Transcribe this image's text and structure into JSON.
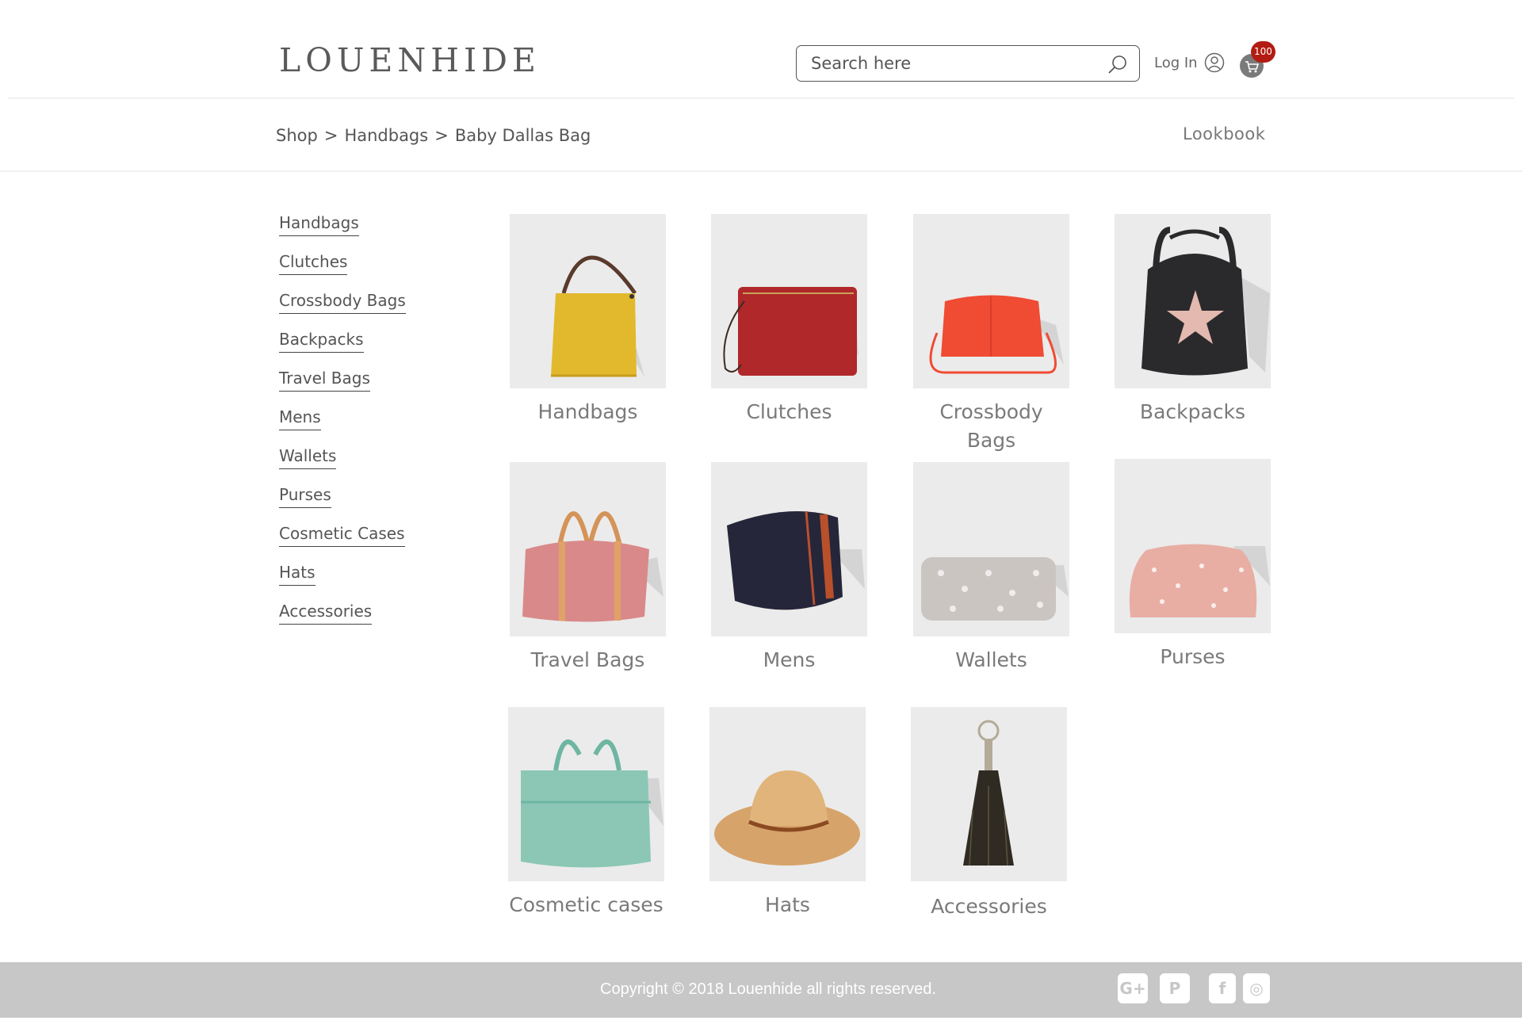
{
  "header": {
    "logo": "LOUENHIDE",
    "search_placeholder": "Search here",
    "login_label": "Log In",
    "cart_count": "100"
  },
  "breadcrumb": {
    "items": [
      "Shop",
      ">",
      "Handbags",
      ">",
      "Baby Dallas Bag"
    ]
  },
  "lookbook_label": "Lookbook",
  "sidebar": {
    "items": [
      {
        "label": "Handbags"
      },
      {
        "label": "Clutches"
      },
      {
        "label": "Crossbody Bags"
      },
      {
        "label": "Backpacks"
      },
      {
        "label": "Travel Bags"
      },
      {
        "label": "Mens"
      },
      {
        "label": "Wallets"
      },
      {
        "label": "Purses"
      },
      {
        "label": "Cosmetic Cases"
      },
      {
        "label": "Hats"
      },
      {
        "label": "Accessories"
      }
    ]
  },
  "categories": [
    {
      "label": "Handbags",
      "icon": "yellow-handbag-image",
      "color": "#e2b92d"
    },
    {
      "label": "Clutches",
      "icon": "red-clutch-image",
      "color": "#b0282a"
    },
    {
      "label": "Crossbody Bags",
      "icon": "orange-crossbody-image",
      "color": "#f04b33"
    },
    {
      "label": "Backpacks",
      "icon": "black-star-backpack-image",
      "color": "#2a2a2c"
    },
    {
      "label": "Travel Bags",
      "icon": "pink-travel-bag-image",
      "color": "#d9898a"
    },
    {
      "label": "Mens",
      "icon": "navy-toiletry-bag-image",
      "color": "#26263a"
    },
    {
      "label": "Wallets",
      "icon": "grey-pattern-pouch-image",
      "color": "#cbc5c1"
    },
    {
      "label": "Purses",
      "icon": "pink-spotted-purse-image",
      "color": "#e8aea4"
    },
    {
      "label": "Cosmetic cases",
      "icon": "mint-cosmetic-case-image",
      "color": "#8cc7b6"
    },
    {
      "label": "Hats",
      "icon": "straw-hat-image",
      "color": "#d6a36b"
    },
    {
      "label": "Accessories",
      "icon": "tassel-keyring-image",
      "color": "#2f2b22"
    }
  ],
  "footer": {
    "copyright": "Copyright © 2018 Louenhide all rights reserved.",
    "social": [
      {
        "icon": "google-plus-icon",
        "glyph": "G+"
      },
      {
        "icon": "pinterest-icon",
        "glyph": "P"
      },
      {
        "icon": "facebook-icon",
        "glyph": "f"
      },
      {
        "icon": "instagram-icon",
        "glyph": "◎"
      }
    ]
  },
  "colors": {
    "footer_bg": "#c7c7c7",
    "badge": "#b31c12",
    "tile_bg": "#ebebeb"
  }
}
